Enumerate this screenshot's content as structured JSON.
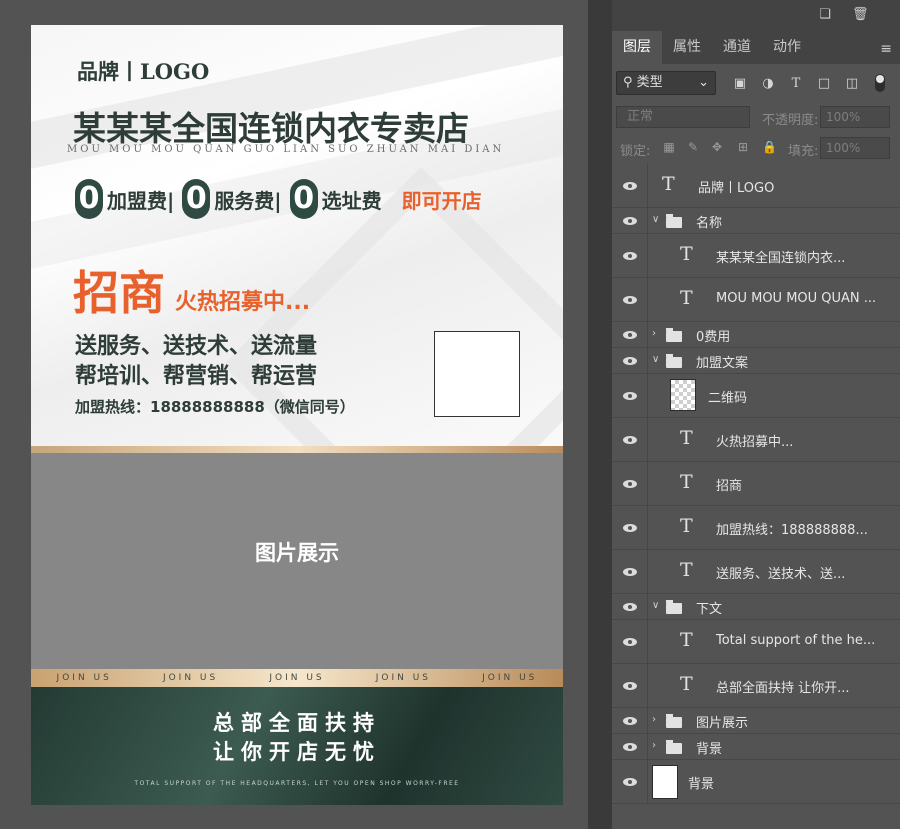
{
  "poster": {
    "brand": "品牌丨LOGO",
    "shop_name": "某某某全国连锁内衣专卖店",
    "shop_pinyin": "MOU MOU MOU QUAN GUO LIAN SUO ZHUAN MAI DIAN",
    "fees": [
      {
        "zero": "0",
        "label": "加盟费|"
      },
      {
        "zero": "0",
        "label": "服务费|"
      },
      {
        "zero": "0",
        "label": "选址费"
      }
    ],
    "fee_cta": "即可开店",
    "recruit_title": "招商",
    "recruit_sub": "火热招募中...",
    "service_line1": "送服务、送技术、送流量",
    "service_line2": "帮培训、帮营销、帮运营",
    "hotline": "加盟热线：18888888888（微信同号）",
    "photo_label": "图片展示",
    "joinus": [
      "JOIN US",
      "JOIN US",
      "JOIN US",
      "JOIN US",
      "JOIN US"
    ],
    "slogan_line1": "总部全面扶持",
    "slogan_line2": "让你开店无忧",
    "slogan_en": "TOTAL SUPPORT OF THE HEADQUARTERS, LET YOU OPEN SHOP WORRY-FREE"
  },
  "panel": {
    "tabs": [
      "图层",
      "属性",
      "通道",
      "动作"
    ],
    "active_tab": "图层",
    "filter_label": "类型",
    "blend_mode": "正常",
    "opacity_label": "不透明度:",
    "opacity_value": "100%",
    "lock_label": "锁定:",
    "fill_label": "填充:",
    "fill_value": "100%",
    "layers": [
      {
        "type": "text",
        "name": "品牌丨LOGO",
        "indent": 0
      },
      {
        "type": "group-open",
        "name": "名称",
        "indent": 0
      },
      {
        "type": "text",
        "name": "某某某全国连锁内衣...",
        "indent": 1
      },
      {
        "type": "text",
        "name": "MOU MOU MOU QUAN ...",
        "indent": 1
      },
      {
        "type": "group-closed",
        "name": "0费用",
        "indent": 0
      },
      {
        "type": "group-open",
        "name": "加盟文案",
        "indent": 0
      },
      {
        "type": "smart",
        "name": "二维码",
        "indent": 1
      },
      {
        "type": "text",
        "name": "火热招募中...",
        "indent": 1
      },
      {
        "type": "text",
        "name": "招商",
        "indent": 1
      },
      {
        "type": "text",
        "name": "加盟热线：188888888...",
        "indent": 1
      },
      {
        "type": "text",
        "name": "送服务、送技术、送...",
        "indent": 1
      },
      {
        "type": "group-open",
        "name": "下文",
        "indent": 0
      },
      {
        "type": "text",
        "name": "Total support of the he...",
        "indent": 1
      },
      {
        "type": "text",
        "name": "总部全面扶持 让你开...",
        "indent": 1
      },
      {
        "type": "group-closed",
        "name": "图片展示",
        "indent": 0
      },
      {
        "type": "group-closed",
        "name": "背景",
        "indent": 0
      },
      {
        "type": "image",
        "name": "背景",
        "indent": 0
      }
    ]
  },
  "icons": [
    "new-layer-icon",
    "trash-icon",
    "panel-menu-icon",
    "search-icon",
    "image-filter-icon",
    "adjustment-filter-icon",
    "type-filter-icon",
    "shape-filter-icon",
    "smart-object-filter-icon",
    "eye-icon",
    "folder-icon",
    "text-layer-icon"
  ]
}
